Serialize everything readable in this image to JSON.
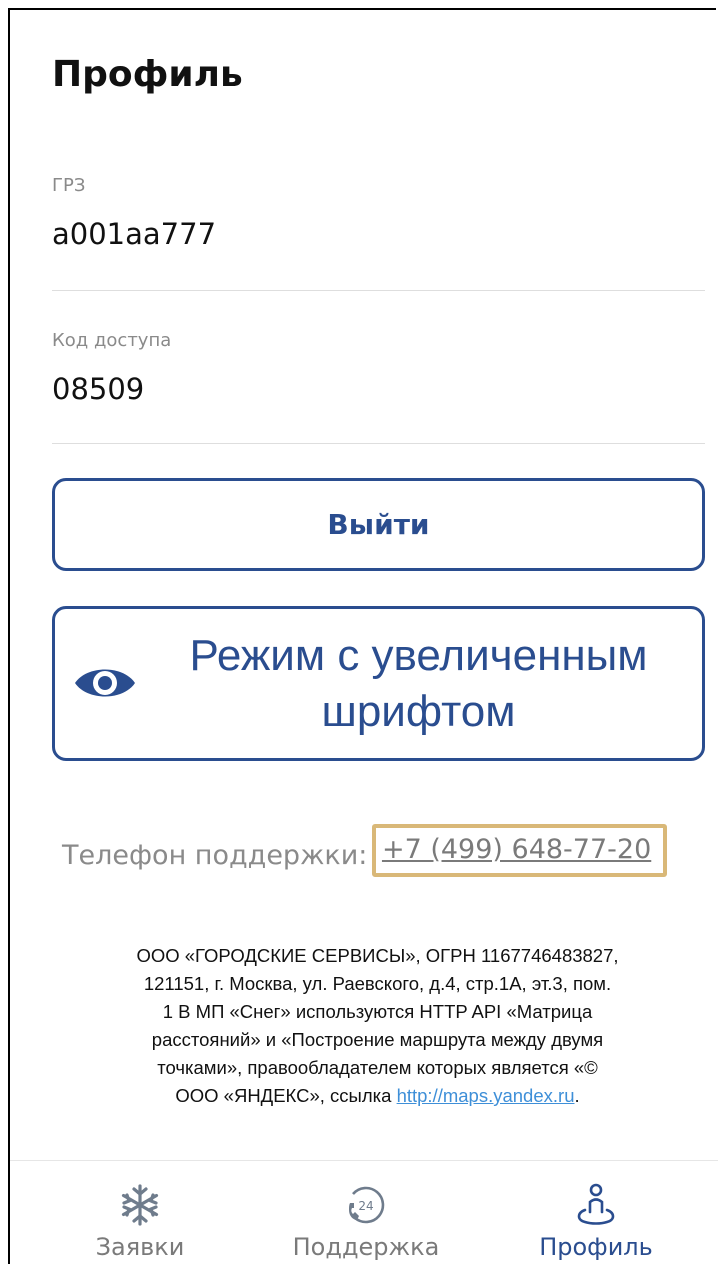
{
  "header": {
    "title": "Профиль"
  },
  "fields": [
    {
      "label": "ГРЗ",
      "value": "а001аа777"
    },
    {
      "label": "Код доступа",
      "value": "08509"
    }
  ],
  "buttons": {
    "logout": "Выйти",
    "large_font_line1": "Режим с увеличенным",
    "large_font_line2": "шрифтом"
  },
  "support": {
    "label": "Телефон поддержки:",
    "phone": "+7 (499) 648-77-20"
  },
  "legal": {
    "text_line1": "ООО «ГОРОДСКИЕ СЕРВИСЫ», ОГРН 1167746483827,",
    "text_line2": "121151, г. Москва, ул. Раевского, д.4, стр.1А, эт.3, пом.",
    "text_line3": "1 В МП «Снег» используются HTTP API «Матрица",
    "text_line4": "расстояний» и «Построение маршрута между двумя",
    "text_line5": "точками», правообладателем которых является «©",
    "text_line6": "ООО «ЯНДЕКС», ссылка",
    "link": "http://maps.yandex.ru",
    "after_link": "."
  },
  "tabbar": {
    "items": [
      {
        "label": "Заявки",
        "icon": "snowflake-icon"
      },
      {
        "label": "Поддержка",
        "icon": "support-24-icon"
      },
      {
        "label": "Профиль",
        "icon": "profile-location-icon",
        "active": true
      }
    ]
  },
  "colors": {
    "accent": "#2a4d8f",
    "highlight_box": "#d9b878",
    "link": "#3e8fd8",
    "muted": "#8a8a8a"
  }
}
